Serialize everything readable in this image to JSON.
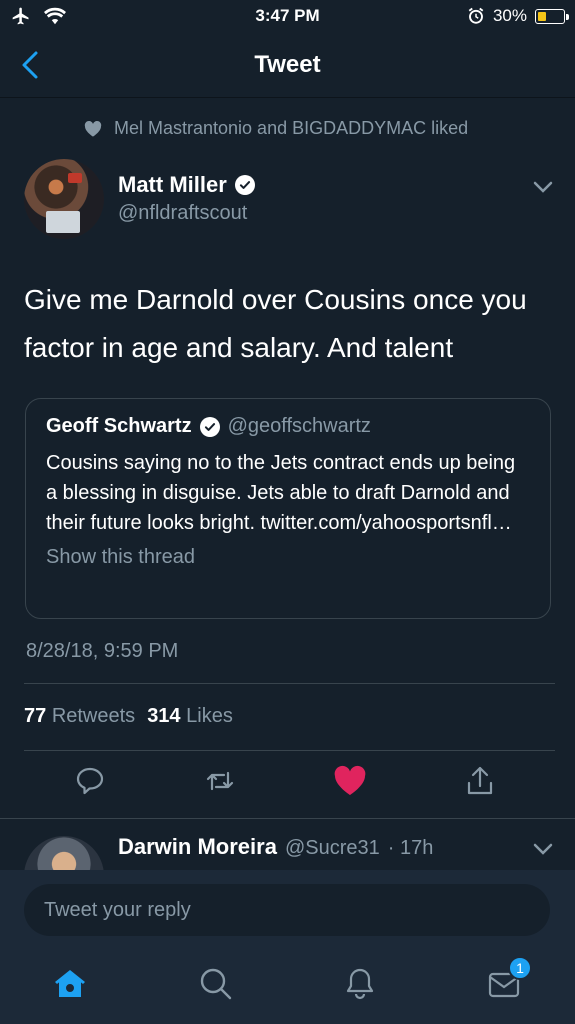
{
  "status_bar": {
    "time": "3:47 PM",
    "battery": "30%"
  },
  "nav": {
    "title": "Tweet"
  },
  "social_context": "Mel Mastrantonio and BIGDADDYMAC liked",
  "tweet": {
    "author_name": "Matt Miller",
    "author_handle": "@nfldraftscout",
    "text": "Give me Darnold over Cousins once you factor in age and salary. And talent",
    "timestamp": "8/28/18, 9:59 PM",
    "retweets_count": "77",
    "retweets_label": "Retweets",
    "likes_count": "314",
    "likes_label": "Likes"
  },
  "quoted": {
    "name": "Geoff Schwartz",
    "handle": "@geoffschwartz",
    "text": "Cousins saying no to the Jets contract ends up being a blessing in disguise. Jets able to draft Darnold and their future looks bright. twitter.com/yahoosportsnfl…",
    "thread_link": "Show this thread"
  },
  "reply": {
    "name": "Darwin Moreira",
    "handle": "@Sucre31",
    "time": "· 17h"
  },
  "compose": {
    "placeholder": "Tweet your reply"
  },
  "tabbar": {
    "messages_badge": "1"
  },
  "colors": {
    "background": "#15202b",
    "accent": "#1da1f2",
    "like_red": "#e0245e",
    "muted": "#8899a6"
  }
}
